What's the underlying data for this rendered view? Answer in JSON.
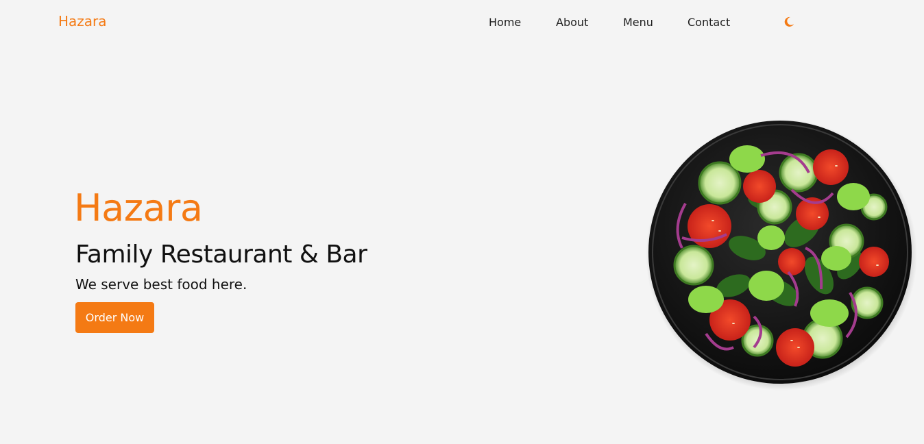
{
  "header": {
    "logo": "Hazara",
    "nav": [
      "Home",
      "About",
      "Menu",
      "Contact"
    ],
    "theme_toggle_icon": "moon-icon"
  },
  "hero": {
    "title": "Hazara",
    "subtitle": "Family Restaurant & Bar",
    "tagline": "We serve best food here.",
    "cta_label": "Order Now",
    "image_icon": "salad-bowl-image"
  },
  "colors": {
    "accent": "#f47a14",
    "background": "#f4f4f4",
    "text": "#111111"
  }
}
